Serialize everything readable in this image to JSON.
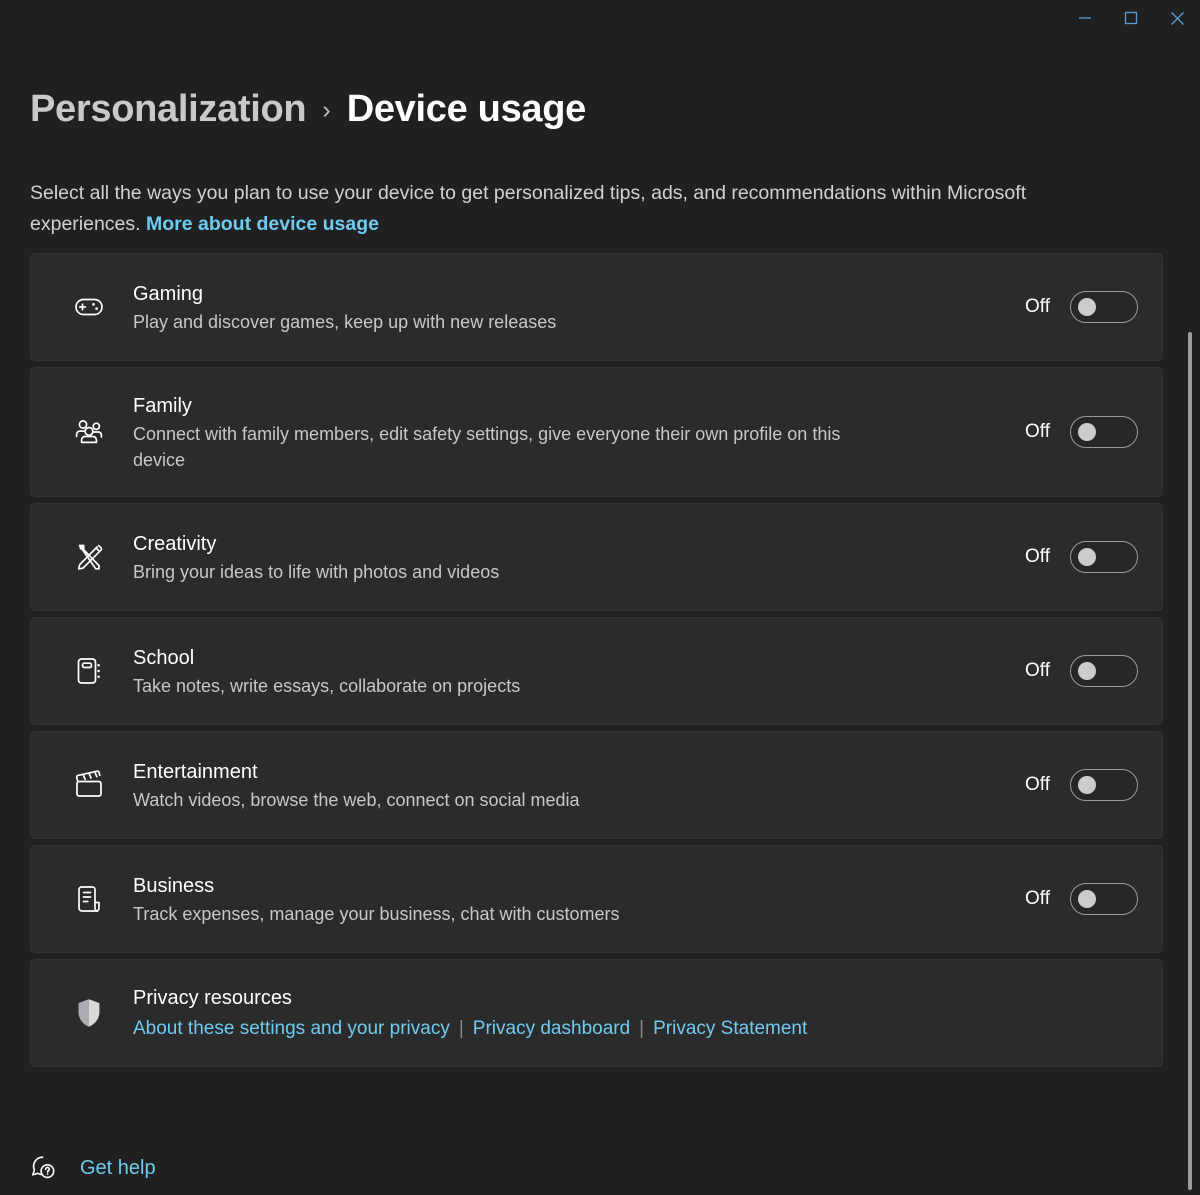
{
  "window": {
    "controls": [
      {
        "name": "minimize",
        "label": "Minimize"
      },
      {
        "name": "maximize",
        "label": "Maximize"
      },
      {
        "name": "close",
        "label": "Close"
      }
    ],
    "control_color": "#5b9bd5"
  },
  "header": {
    "parent_crumb": "Personalization",
    "separator": "›",
    "current_crumb": "Device usage",
    "description_text": "Select all the ways you plan to use your device to get personalized tips, ads, and recommendations within Microsoft experiences.",
    "description_link": "More about device usage"
  },
  "theme": {
    "page_background": "#202020",
    "card_background": "#2b2b2b",
    "accent_link": "#6fcbf2",
    "toggle_knob": "#cccccc"
  },
  "settings": [
    {
      "icon": "gamepad-icon",
      "title": "Gaming",
      "subtitle": "Play and discover games, keep up with new releases",
      "toggle_state": "Off"
    },
    {
      "icon": "people-family-icon",
      "title": "Family",
      "subtitle": "Connect with family members, edit safety settings, give everyone their own profile on this device",
      "toggle_state": "Off"
    },
    {
      "icon": "pen-paintbrush-icon",
      "title": "Creativity",
      "subtitle": "Bring your ideas to life with photos and videos",
      "toggle_state": "Off"
    },
    {
      "icon": "notebook-icon",
      "title": "School",
      "subtitle": "Take notes, write essays, collaborate on projects",
      "toggle_state": "Off"
    },
    {
      "icon": "clapperboard-icon",
      "title": "Entertainment",
      "subtitle": "Watch videos, browse the web, connect on social media",
      "toggle_state": "Off"
    },
    {
      "icon": "receipt-icon",
      "title": "Business",
      "subtitle": "Track expenses, manage your business, chat with customers",
      "toggle_state": "Off"
    }
  ],
  "privacy": {
    "icon": "shield-icon",
    "title": "Privacy resources",
    "links": [
      "About these settings and your privacy",
      "Privacy dashboard",
      "Privacy Statement"
    ],
    "separator": "|"
  },
  "footer": {
    "icon": "question-bubble-icon",
    "get_help_label": "Get help"
  }
}
